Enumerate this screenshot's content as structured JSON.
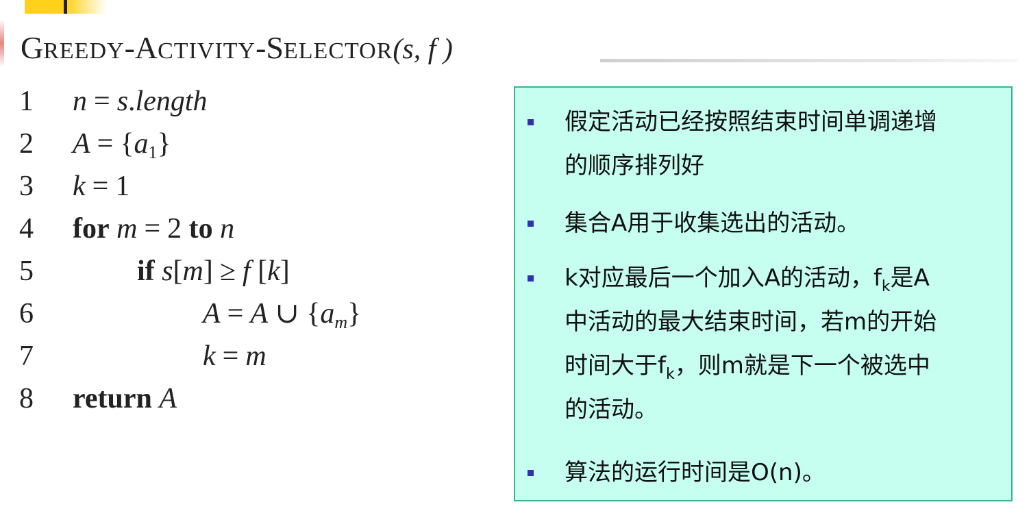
{
  "title": {
    "name_g": "G",
    "name_reedy": "REEDY",
    "name_dash1": "-",
    "name_a": "A",
    "name_ctivity": "CTIVITY",
    "name_dash2": "-",
    "name_s": "S",
    "name_elector": "ELECTOR",
    "args": "(s, f )"
  },
  "code": [
    {
      "num": "1"
    },
    {
      "num": "2"
    },
    {
      "num": "3"
    },
    {
      "num": "4"
    },
    {
      "num": "5"
    },
    {
      "num": "6"
    },
    {
      "num": "7"
    },
    {
      "num": "8"
    }
  ],
  "tokens": {
    "l1_n": "n",
    "l1_eq": "=",
    "l1_s": "s",
    "l1_dot": ".",
    "l1_length": "length",
    "l2_A": "A",
    "l2_eq": "=",
    "l2_open": "{",
    "l2_a": "a",
    "l2_sub": "1",
    "l2_close": "}",
    "l3_k": "k",
    "l3_eq": "=",
    "l3_one": "1",
    "l4_for": "for",
    "l4_m": "m",
    "l4_eq": "=",
    "l4_two": "2",
    "l4_to": "to",
    "l4_n": "n",
    "l5_if": "if",
    "l5_s": "s",
    "l5_lb": "[",
    "l5_m": "m",
    "l5_rb": "]",
    "l5_ge": "≥",
    "l5_f": "f",
    "l5_lb2": "[",
    "l5_k": "k",
    "l5_rb2": "]",
    "l6_A": "A",
    "l6_eq": "=",
    "l6_A2": "A",
    "l6_cup": "∪",
    "l6_open": "{",
    "l6_a": "a",
    "l6_sub": "m",
    "l6_close": "}",
    "l7_k": "k",
    "l7_eq": "=",
    "l7_m": "m",
    "l8_return": "return",
    "l8_A": "A"
  },
  "notes": {
    "n1_l1": "假定活动已经按照结束时间单调递增",
    "n1_l2": "的顺序排列好",
    "n2_l1": "集合A用于收集选出的活动。",
    "n3_l1a": "k对应最后一个加入A的活动，f",
    "n3_l1sub": "k",
    "n3_l1b": "是A",
    "n3_l2": "中活动的最大结束时间，若m的开始",
    "n3_l3a": "时间大于f",
    "n3_l3sub": "k",
    "n3_l3b": "，则m就是下一个被选中",
    "n3_l4": "的活动。",
    "n4_l1": "算法的运行时间是O(n)。"
  },
  "colors": {
    "note_bg": "#c6fff0",
    "note_border": "#35b58f",
    "bullet": "#3030b0",
    "accent": "#ffd11a"
  }
}
